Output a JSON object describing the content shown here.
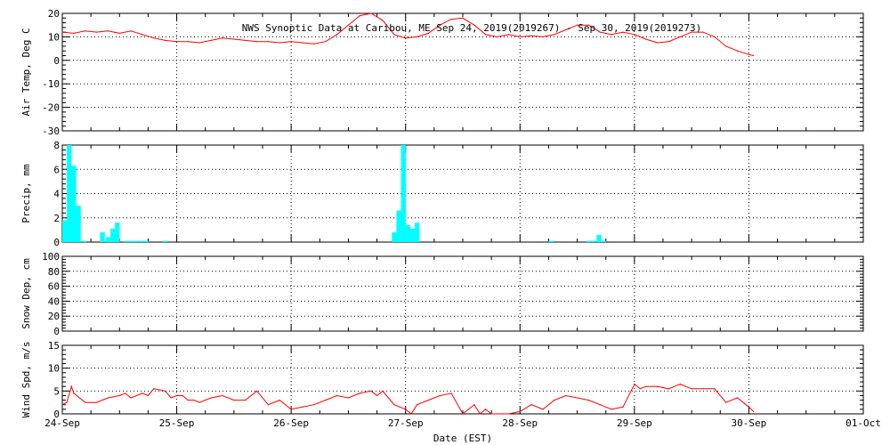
{
  "title": "NWS Synoptic Data at Caribou, ME   Sep 24, 2019(2019267) - Sep 30, 2019(2019273)",
  "x_axis_label": "Date (EST)",
  "x_tick_labels": [
    "24-Sep",
    "25-Sep",
    "26-Sep",
    "27-Sep",
    "28-Sep",
    "29-Sep",
    "30-Sep",
    "01-Oct"
  ],
  "chart_data": [
    {
      "type": "line",
      "ylabel": "Air Temp, Deg C",
      "ylim": [
        -30,
        20
      ],
      "yticks": [
        20,
        10,
        0,
        -10,
        -20,
        -30
      ],
      "xlim": [
        0,
        7
      ],
      "color": "#ff0000",
      "grid": true,
      "x": [
        0.0,
        0.1,
        0.2,
        0.3,
        0.4,
        0.5,
        0.6,
        0.7,
        0.8,
        0.9,
        1.0,
        1.1,
        1.2,
        1.3,
        1.4,
        1.5,
        1.6,
        1.7,
        1.8,
        1.9,
        2.0,
        2.1,
        2.2,
        2.3,
        2.4,
        2.5,
        2.6,
        2.7,
        2.8,
        2.9,
        3.0,
        3.1,
        3.2,
        3.3,
        3.4,
        3.5,
        3.6,
        3.7,
        3.8,
        3.9,
        4.0,
        4.1,
        4.2,
        4.3,
        4.4,
        4.5,
        4.6,
        4.7,
        4.8,
        4.9,
        5.0,
        5.1,
        5.2,
        5.3,
        5.4,
        5.5,
        5.6,
        5.7,
        5.8,
        5.9,
        6.0,
        6.04
      ],
      "y": [
        12.0,
        11.5,
        12.5,
        12.0,
        12.5,
        11.5,
        12.5,
        11.0,
        9.5,
        8.5,
        8.0,
        8.0,
        7.5,
        8.5,
        9.5,
        9.0,
        8.5,
        8.0,
        8.0,
        7.5,
        8.0,
        7.5,
        7.0,
        8.0,
        11.0,
        15.0,
        19.0,
        20.0,
        17.0,
        11.0,
        9.5,
        10.0,
        11.5,
        15.0,
        17.5,
        18.0,
        15.0,
        11.0,
        10.0,
        11.0,
        10.0,
        10.5,
        10.0,
        11.0,
        13.0,
        15.0,
        15.0,
        12.0,
        11.0,
        12.0,
        11.0,
        9.0,
        7.5,
        8.0,
        10.0,
        12.0,
        12.0,
        10.0,
        6.0,
        4.0,
        2.5,
        2.0
      ]
    },
    {
      "type": "bar",
      "ylabel": "Precip, mm",
      "ylim": [
        0,
        8
      ],
      "yticks": [
        8,
        6,
        4,
        2,
        0
      ],
      "xlim": [
        0,
        7
      ],
      "color": "#00ffff",
      "grid": true,
      "x": [
        0.0,
        0.04,
        0.08,
        0.12,
        0.17,
        0.33,
        0.38,
        0.42,
        0.46,
        0.54,
        0.58,
        0.62,
        0.67,
        0.71,
        0.88,
        2.88,
        2.92,
        2.96,
        3.0,
        3.04,
        3.08,
        4.25,
        4.58,
        4.62,
        4.67,
        4.71
      ],
      "values": [
        1.8,
        8.7,
        6.3,
        3.0,
        0.1,
        0.8,
        0.4,
        1.1,
        1.6,
        0.1,
        0.1,
        0.1,
        0.1,
        0.1,
        0.1,
        0.8,
        2.6,
        9.1,
        1.4,
        1.1,
        1.6,
        0.1,
        0.1,
        0.1,
        0.6,
        0.1
      ]
    },
    {
      "type": "line",
      "ylabel": "Snow Dep, cm",
      "ylim": [
        0,
        100
      ],
      "yticks": [
        100,
        80,
        60,
        40,
        20,
        0
      ],
      "xlim": [
        0,
        7
      ],
      "grid": true,
      "x": [],
      "y": []
    },
    {
      "type": "line",
      "ylabel": "Wind Spd, m/s",
      "ylim": [
        0,
        15
      ],
      "yticks": [
        15,
        10,
        5,
        0
      ],
      "xlim": [
        0,
        7
      ],
      "color": "#ff0000",
      "grid": true,
      "x": [
        0.0,
        0.04,
        0.08,
        0.1,
        0.15,
        0.2,
        0.3,
        0.4,
        0.5,
        0.55,
        0.6,
        0.7,
        0.75,
        0.8,
        0.9,
        0.95,
        1.0,
        1.05,
        1.1,
        1.15,
        1.2,
        1.3,
        1.4,
        1.5,
        1.6,
        1.7,
        1.8,
        1.9,
        2.0,
        2.1,
        2.2,
        2.3,
        2.4,
        2.5,
        2.6,
        2.7,
        2.75,
        2.8,
        2.85,
        2.9,
        3.0,
        3.05,
        3.1,
        3.2,
        3.3,
        3.4,
        3.5,
        3.6,
        3.65,
        3.7,
        3.75,
        3.8,
        3.85,
        3.9,
        4.0,
        4.1,
        4.2,
        4.3,
        4.4,
        4.5,
        4.6,
        4.7,
        4.8,
        4.9,
        5.0,
        5.05,
        5.1,
        5.2,
        5.3,
        5.4,
        5.5,
        5.6,
        5.7,
        5.8,
        5.9,
        6.0,
        6.04
      ],
      "y": [
        2,
        2.5,
        6,
        4.5,
        3.5,
        2.5,
        2.5,
        3.5,
        4,
        4.5,
        3.5,
        4.5,
        4,
        5.5,
        5,
        3.5,
        4,
        4,
        3,
        3,
        2.5,
        3.5,
        4,
        3,
        3,
        5,
        2,
        3,
        1,
        1.5,
        2,
        3,
        4,
        3.5,
        4.5,
        5,
        4,
        5,
        3.5,
        2,
        1,
        0,
        2,
        3,
        4,
        4.5,
        0,
        2,
        0,
        1,
        0,
        0,
        0,
        0,
        0.5,
        2,
        1,
        3,
        4,
        3.5,
        3,
        2,
        1,
        1.5,
        6.5,
        5.5,
        6,
        6,
        5.5,
        6.5,
        5.5,
        5.5,
        5.5,
        2.5,
        3.5,
        1.5,
        0.5
      ]
    }
  ]
}
